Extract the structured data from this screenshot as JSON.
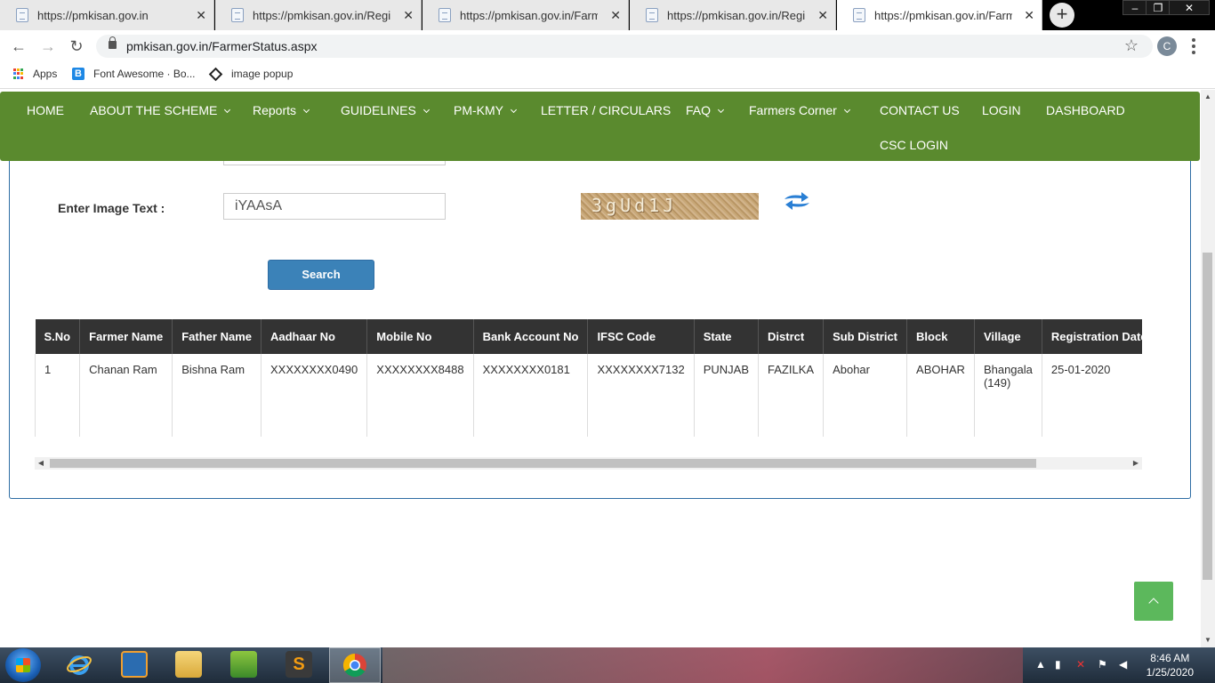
{
  "browser": {
    "tabs": [
      {
        "title": "https://pmkisan.gov.in",
        "active": false
      },
      {
        "title": "https://pmkisan.gov.in/Registrat",
        "active": false
      },
      {
        "title": "https://pmkisan.gov.in/FarmerSt",
        "active": false
      },
      {
        "title": "https://pmkisan.gov.in/Registrat",
        "active": false
      },
      {
        "title": "https://pmkisan.gov.in/FarmerSt",
        "active": true
      }
    ],
    "url": "pmkisan.gov.in/FarmerStatus.aspx",
    "profile_initial": "C",
    "bookmarks": [
      {
        "label": "Apps",
        "icon": "apps-grid-icon"
      },
      {
        "label": "Font Awesome · Bo...",
        "icon": "bootstrap-b-icon"
      },
      {
        "label": "image popup",
        "icon": "codepen-icon"
      }
    ]
  },
  "nav": {
    "items": [
      {
        "label": "HOME",
        "dropdown": false
      },
      {
        "label": "ABOUT THE SCHEME",
        "dropdown": true
      },
      {
        "label": "Reports",
        "dropdown": true
      },
      {
        "label": "GUIDELINES",
        "dropdown": true
      },
      {
        "label": "PM-KMY",
        "dropdown": true
      },
      {
        "label": "LETTER / CIRCULARS",
        "dropdown": false
      },
      {
        "label": "FAQ",
        "dropdown": true
      },
      {
        "label": "Farmers Corner",
        "dropdown": true
      },
      {
        "label": "CONTACT US",
        "dropdown": false
      },
      {
        "label": "LOGIN",
        "dropdown": false
      },
      {
        "label": "DASHBOARD",
        "dropdown": false
      },
      {
        "label": "CSC LOGIN",
        "dropdown": false
      }
    ],
    "color": "#5a8a2e"
  },
  "form": {
    "captcha_label": "Enter Image Text :",
    "captcha_value": "iYAAsA",
    "captcha_image_text": "3gUd1J",
    "search_label": "Search"
  },
  "table": {
    "headers": [
      "S.No",
      "Farmer Name",
      "Father Name",
      "Aadhaar No",
      "Mobile No",
      "Bank Account No",
      "IFSC Code",
      "State",
      "Distrct",
      "Sub District",
      "Block",
      "Village",
      "Registration Date"
    ],
    "rows": [
      [
        "1",
        "Chanan Ram",
        "Bishna Ram",
        "XXXXXXXX0490",
        "XXXXXXXX8488",
        "XXXXXXXX0181",
        "XXXXXXXX7132",
        "PUNJAB",
        "FAZILKA",
        "Abohar",
        "ABOHAR",
        "Bhangala (149)",
        "25-01-2020"
      ]
    ]
  },
  "taskbar": {
    "time": "8:46 AM",
    "date": "1/25/2020"
  }
}
